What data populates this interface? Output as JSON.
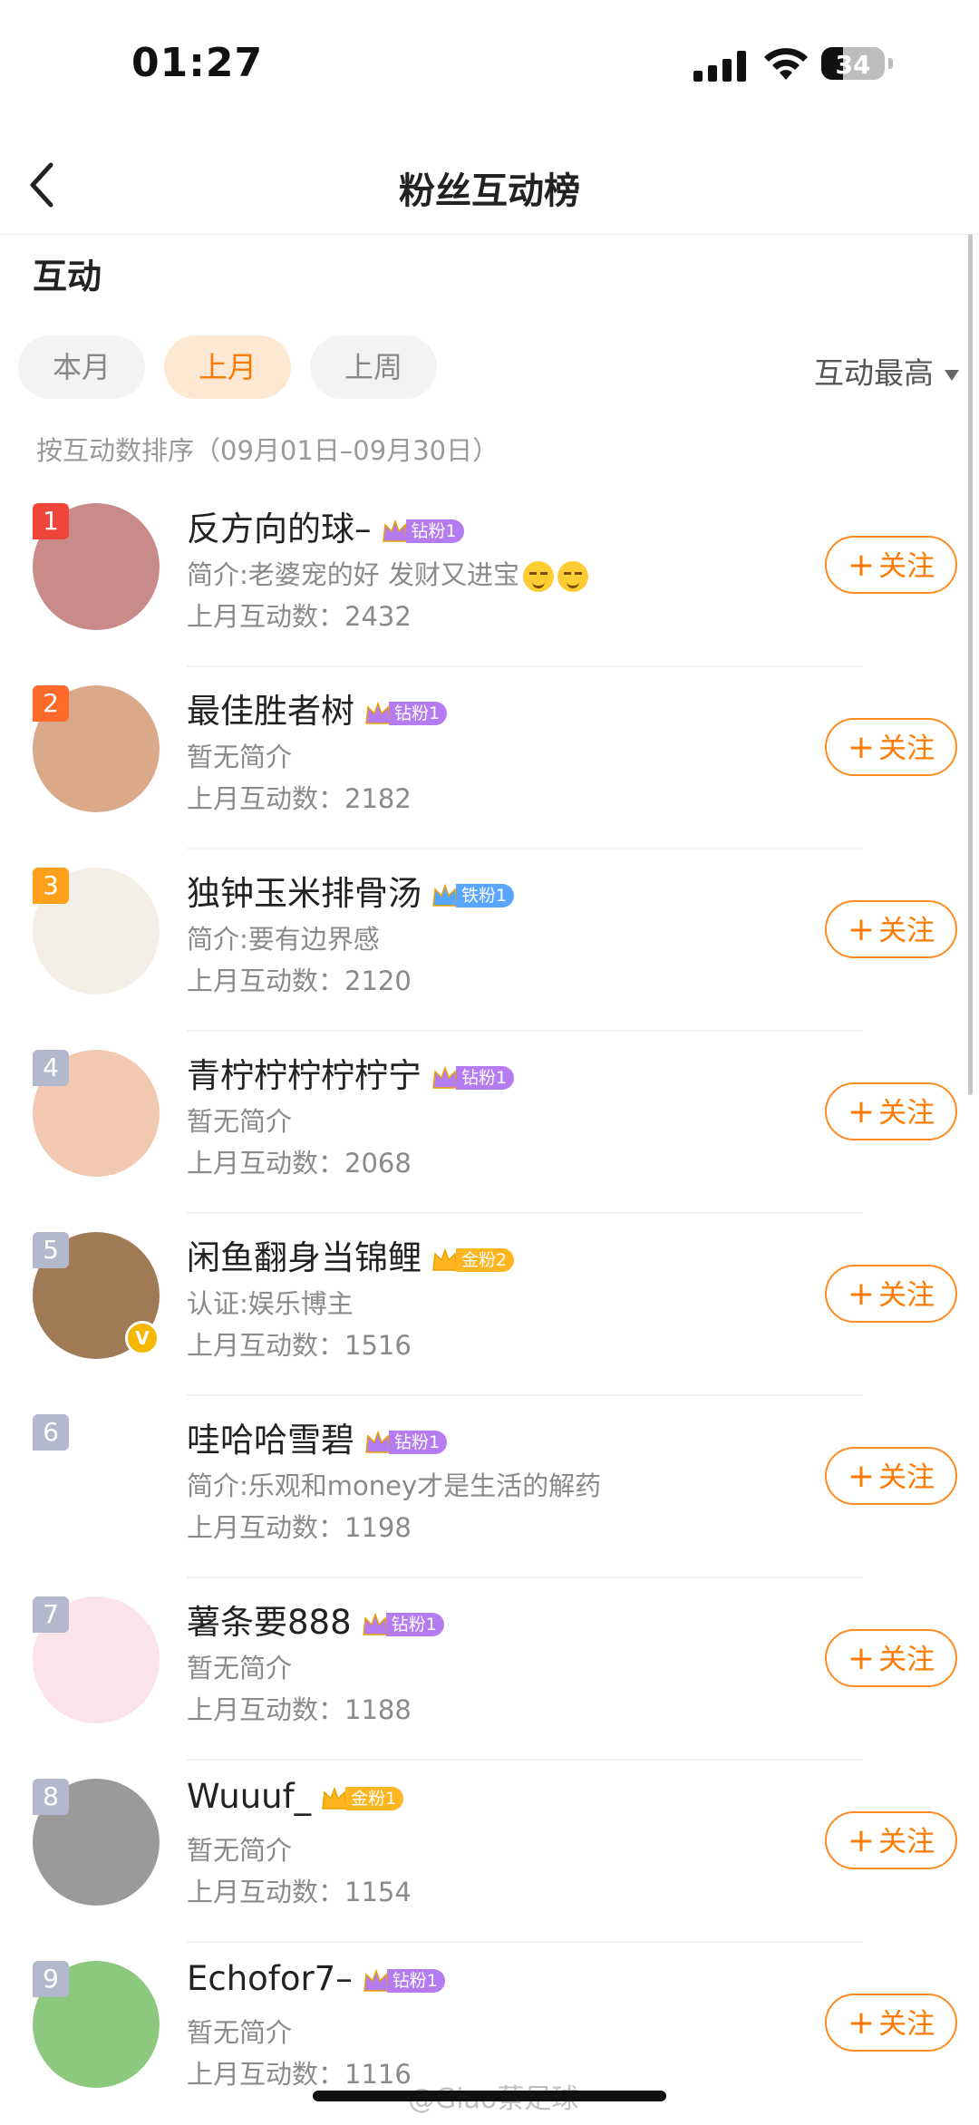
{
  "status_bar": {
    "time": "01:27",
    "battery": "34",
    "battery_level": 0.34
  },
  "nav": {
    "title": "粉丝互动榜"
  },
  "section_title": "互动",
  "tabs": [
    {
      "label": "本月",
      "active": false
    },
    {
      "label": "上月",
      "active": true
    },
    {
      "label": "上周",
      "active": false
    }
  ],
  "sort_label": "互动最高",
  "sort_description": "按互动数排序（09月01日–09月30日）",
  "accent_color": "#ff7a00",
  "follow_label": "关注",
  "fans": [
    {
      "rank": "1",
      "name": "反方向的球–",
      "badge": "钻粉1",
      "badge_color": "#b47cf0",
      "bio": "简介:老婆宠的好 发财又进宝",
      "bio_emoji": 2,
      "count": "上月互动数：2432",
      "avatar_color": "#c98a8a"
    },
    {
      "rank": "2",
      "name": "最佳胜者树",
      "badge": "钻粉1",
      "badge_color": "#b47cf0",
      "bio": "暂无简介",
      "bio_emoji": 0,
      "count": "上月互动数：2182",
      "avatar_color": "#d9a98a"
    },
    {
      "rank": "3",
      "name": "独钟玉米排骨汤",
      "badge": "铁粉1",
      "badge_color": "#59a6ff",
      "bio": "简介:要有边界感",
      "bio_emoji": 0,
      "count": "上月互动数：2120",
      "avatar_color": "#f4efe6"
    },
    {
      "rank": "4",
      "name": "青柠柠柠柠柠宁",
      "badge": "钻粉1",
      "badge_color": "#b47cf0",
      "bio": "暂无简介",
      "bio_emoji": 0,
      "count": "上月互动数：2068",
      "avatar_color": "#f2c9b0"
    },
    {
      "rank": "5",
      "name": "闲鱼翻身当锦鲤",
      "badge": "金粉2",
      "badge_color": "#ffb51f",
      "bio": "认证:娱乐博主",
      "bio_emoji": 0,
      "count": "上月互动数：1516",
      "avatar_color": "#a07a55",
      "verified": true
    },
    {
      "rank": "6",
      "name": "哇哈哈雪碧",
      "badge": "钻粉1",
      "badge_color": "#b47cf0",
      "bio": "简介:乐观和money才是生活的解药",
      "bio_emoji": 0,
      "count": "上月互动数：1198",
      "avatar_color": "#ffffff"
    },
    {
      "rank": "7",
      "name": "薯条要888",
      "badge": "钻粉1",
      "badge_color": "#b47cf0",
      "bio": "暂无简介",
      "bio_emoji": 0,
      "count": "上月互动数：1188",
      "avatar_color": "#fbe3ea"
    },
    {
      "rank": "8",
      "name": "Wuuuf_",
      "badge": "金粉1",
      "badge_color": "#ffb51f",
      "bio": "暂无简介",
      "bio_emoji": 0,
      "count": "上月互动数：1154",
      "avatar_color": "#9a9a9a"
    },
    {
      "rank": "9",
      "name": "Echofor7–",
      "badge": "钻粉1",
      "badge_color": "#b47cf0",
      "bio": "暂无简介",
      "bio_emoji": 0,
      "count": "上月互动数：1116",
      "avatar_color": "#8cc97f"
    }
  ],
  "rank_colors": {
    "1": "#f0453a",
    "2": "#ff6a2a",
    "3": "#ff9f1a",
    "other": "#b4b8cc"
  },
  "watermark": "@Giao蔡足球"
}
